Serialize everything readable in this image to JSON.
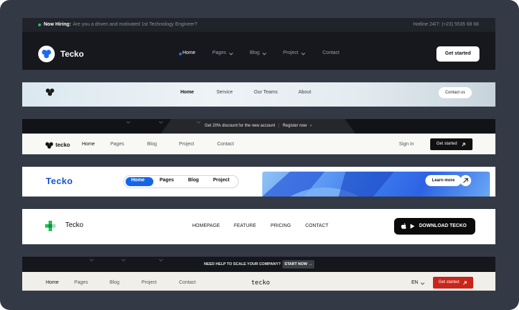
{
  "header1": {
    "topbar": {
      "hiring_label": "Now Hiring:",
      "hiring_message": "Are you a driven and motivated 1st Technology Engineer?",
      "hotline": "Hotline 24/7: (+23) 5535 68 68"
    },
    "brand": "Tecko",
    "nav": [
      "Home",
      "Pages",
      "Blog",
      "Project",
      "Contact"
    ],
    "cta": "Get started",
    "colors": {
      "background": "#16181d",
      "accent": "#2f6bff",
      "online_dot": "#22c55e"
    }
  },
  "header2": {
    "nav": [
      "Home",
      "Service",
      "Our Teams",
      "About"
    ],
    "cta": "Contact us"
  },
  "header3": {
    "promo_text": "Get 20% discount for the new account",
    "promo_link": "Register now",
    "brand": "tecko",
    "nav": [
      "Home",
      "Pages",
      "Blog",
      "Project",
      "Contact"
    ],
    "sign_in": "Sign in",
    "cta": "Get started"
  },
  "header4": {
    "brand": "Tecko",
    "nav": [
      "Home",
      "Pages",
      "Blog",
      "Project"
    ],
    "cta": "Learn more",
    "colors": {
      "brand": "#1556d6",
      "active": "#1565e8"
    }
  },
  "header5": {
    "brand": "Tecko",
    "nav": [
      "HOMEPAGE",
      "FEATURE",
      "PRICING",
      "CONTACT"
    ],
    "cta": "DOWNLOAD TECKO",
    "colors": {
      "brand_logo": "#21c15b"
    }
  },
  "header6": {
    "help_text": "NEED HELP TO SCALE YOUR COMPANY?",
    "help_link": "START NOW",
    "nav": [
      "Home",
      "Pages",
      "Blog",
      "Project",
      "Contact"
    ],
    "brand": "tecko",
    "language": "EN",
    "cta": "Get started",
    "colors": {
      "cta": "#c8261b"
    }
  }
}
